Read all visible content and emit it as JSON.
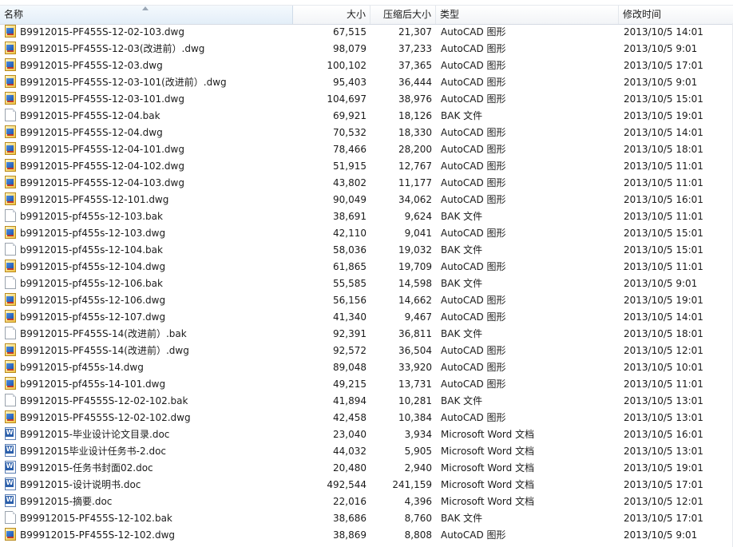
{
  "header": {
    "name": "名称",
    "size": "大小",
    "compressed": "压缩后大小",
    "type": "类型",
    "modified": "修改时间"
  },
  "files": [
    {
      "name": "B9912015-PF455S-12-02-103.dwg",
      "size": "67,515",
      "compressed": "21,307",
      "type": "AutoCAD 图形",
      "modified": "2013/10/5 14:01",
      "icon": "dwg"
    },
    {
      "name": "B9912015-PF455S-12-03(改进前）.dwg",
      "size": "98,079",
      "compressed": "37,233",
      "type": "AutoCAD 图形",
      "modified": "2013/10/5 9:01",
      "icon": "dwg"
    },
    {
      "name": "B9912015-PF455S-12-03.dwg",
      "size": "100,102",
      "compressed": "37,365",
      "type": "AutoCAD 图形",
      "modified": "2013/10/5 17:01",
      "icon": "dwg"
    },
    {
      "name": "B9912015-PF455S-12-03-101(改进前）.dwg",
      "size": "95,403",
      "compressed": "36,444",
      "type": "AutoCAD 图形",
      "modified": "2013/10/5 9:01",
      "icon": "dwg"
    },
    {
      "name": "B9912015-PF455S-12-03-101.dwg",
      "size": "104,697",
      "compressed": "38,976",
      "type": "AutoCAD 图形",
      "modified": "2013/10/5 15:01",
      "icon": "dwg"
    },
    {
      "name": "B9912015-PF455S-12-04.bak",
      "size": "69,921",
      "compressed": "18,126",
      "type": "BAK 文件",
      "modified": "2013/10/5 19:01",
      "icon": "bak"
    },
    {
      "name": "B9912015-PF455S-12-04.dwg",
      "size": "70,532",
      "compressed": "18,330",
      "type": "AutoCAD 图形",
      "modified": "2013/10/5 14:01",
      "icon": "dwg"
    },
    {
      "name": "B9912015-PF455S-12-04-101.dwg",
      "size": "78,466",
      "compressed": "28,200",
      "type": "AutoCAD 图形",
      "modified": "2013/10/5 18:01",
      "icon": "dwg"
    },
    {
      "name": "B9912015-PF455S-12-04-102.dwg",
      "size": "51,915",
      "compressed": "12,767",
      "type": "AutoCAD 图形",
      "modified": "2013/10/5 11:01",
      "icon": "dwg"
    },
    {
      "name": "B9912015-PF455S-12-04-103.dwg",
      "size": "43,802",
      "compressed": "11,177",
      "type": "AutoCAD 图形",
      "modified": "2013/10/5 11:01",
      "icon": "dwg"
    },
    {
      "name": "B9912015-PF455S-12-101.dwg",
      "size": "90,049",
      "compressed": "34,062",
      "type": "AutoCAD 图形",
      "modified": "2013/10/5 16:01",
      "icon": "dwg"
    },
    {
      "name": "b9912015-pf455s-12-103.bak",
      "size": "38,691",
      "compressed": "9,624",
      "type": "BAK 文件",
      "modified": "2013/10/5 11:01",
      "icon": "bak"
    },
    {
      "name": "b9912015-pf455s-12-103.dwg",
      "size": "42,110",
      "compressed": "9,041",
      "type": "AutoCAD 图形",
      "modified": "2013/10/5 15:01",
      "icon": "dwg"
    },
    {
      "name": "b9912015-pf455s-12-104.bak",
      "size": "58,036",
      "compressed": "19,032",
      "type": "BAK 文件",
      "modified": "2013/10/5 15:01",
      "icon": "bak"
    },
    {
      "name": "b9912015-pf455s-12-104.dwg",
      "size": "61,865",
      "compressed": "19,709",
      "type": "AutoCAD 图形",
      "modified": "2013/10/5 11:01",
      "icon": "dwg"
    },
    {
      "name": "b9912015-pf455s-12-106.bak",
      "size": "55,585",
      "compressed": "14,598",
      "type": "BAK 文件",
      "modified": "2013/10/5 9:01",
      "icon": "bak"
    },
    {
      "name": "b9912015-pf455s-12-106.dwg",
      "size": "56,156",
      "compressed": "14,662",
      "type": "AutoCAD 图形",
      "modified": "2013/10/5 19:01",
      "icon": "dwg"
    },
    {
      "name": "b9912015-pf455s-12-107.dwg",
      "size": "41,340",
      "compressed": "9,467",
      "type": "AutoCAD 图形",
      "modified": "2013/10/5 14:01",
      "icon": "dwg"
    },
    {
      "name": "B9912015-PF455S-14(改进前）.bak",
      "size": "92,391",
      "compressed": "36,811",
      "type": "BAK 文件",
      "modified": "2013/10/5 18:01",
      "icon": "bak"
    },
    {
      "name": "B9912015-PF455S-14(改进前）.dwg",
      "size": "92,572",
      "compressed": "36,504",
      "type": "AutoCAD 图形",
      "modified": "2013/10/5 12:01",
      "icon": "dwg"
    },
    {
      "name": "b9912015-pf455s-14.dwg",
      "size": "89,048",
      "compressed": "33,920",
      "type": "AutoCAD 图形",
      "modified": "2013/10/5 10:01",
      "icon": "dwg"
    },
    {
      "name": "b9912015-pf455s-14-101.dwg",
      "size": "49,215",
      "compressed": "13,731",
      "type": "AutoCAD 图形",
      "modified": "2013/10/5 11:01",
      "icon": "dwg"
    },
    {
      "name": "B9912015-PF4555S-12-02-102.bak",
      "size": "41,894",
      "compressed": "10,281",
      "type": "BAK 文件",
      "modified": "2013/10/5 13:01",
      "icon": "bak"
    },
    {
      "name": "B9912015-PF4555S-12-02-102.dwg",
      "size": "42,458",
      "compressed": "10,384",
      "type": "AutoCAD 图形",
      "modified": "2013/10/5 13:01",
      "icon": "dwg"
    },
    {
      "name": "B9912015-毕业设计论文目录.doc",
      "size": "23,040",
      "compressed": "3,934",
      "type": "Microsoft Word 文档",
      "modified": "2013/10/5 16:01",
      "icon": "doc"
    },
    {
      "name": "B9912015毕业设计任务书-2.doc",
      "size": "44,032",
      "compressed": "5,905",
      "type": "Microsoft Word 文档",
      "modified": "2013/10/5 13:01",
      "icon": "doc"
    },
    {
      "name": "B9912015-任务书封面02.doc",
      "size": "20,480",
      "compressed": "2,940",
      "type": "Microsoft Word 文档",
      "modified": "2013/10/5 19:01",
      "icon": "doc"
    },
    {
      "name": "B9912015-设计说明书.doc",
      "size": "492,544",
      "compressed": "241,159",
      "type": "Microsoft Word 文档",
      "modified": "2013/10/5 17:01",
      "icon": "doc"
    },
    {
      "name": "B9912015-摘要.doc",
      "size": "22,016",
      "compressed": "4,396",
      "type": "Microsoft Word 文档",
      "modified": "2013/10/5 12:01",
      "icon": "doc"
    },
    {
      "name": "B99912015-PF455S-12-102.bak",
      "size": "38,686",
      "compressed": "8,760",
      "type": "BAK 文件",
      "modified": "2013/10/5 17:01",
      "icon": "bak"
    },
    {
      "name": "B99912015-PF455S-12-102.dwg",
      "size": "38,869",
      "compressed": "8,808",
      "type": "AutoCAD 图形",
      "modified": "2013/10/5 9:01",
      "icon": "dwg"
    }
  ]
}
